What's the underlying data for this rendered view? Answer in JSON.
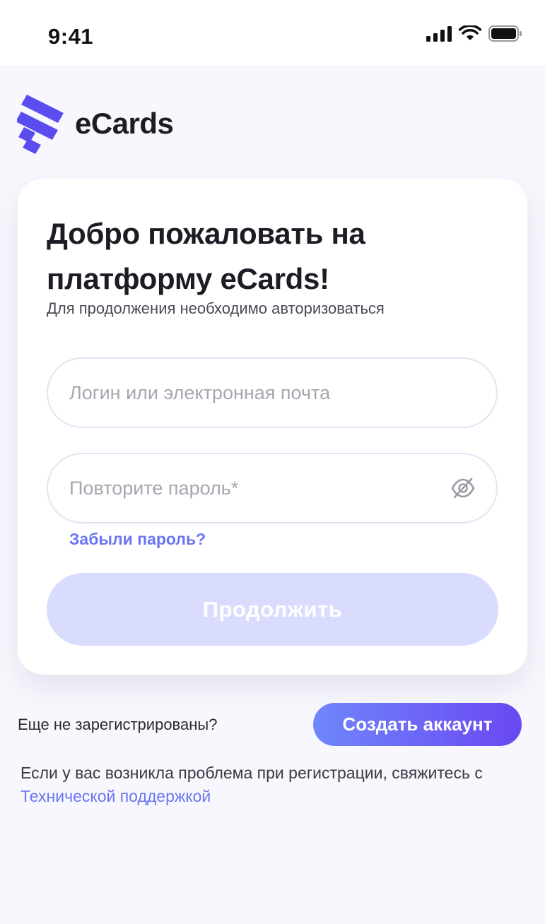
{
  "status_bar": {
    "time": "9:41",
    "signal_icon": "cellular-signal-icon",
    "wifi_icon": "wifi-icon",
    "battery_icon": "battery-icon"
  },
  "brand": {
    "name": "eCards",
    "logo_icon": "ecards-logo-icon",
    "color": "#5b4cf0"
  },
  "card": {
    "title": "Добро пожаловать на платформу eCards!",
    "subtitle": "Для продолжения необходимо авторизоваться",
    "login": {
      "placeholder": "Логин или электронная почта",
      "value": ""
    },
    "password": {
      "placeholder": "Повторите пароль*",
      "value": "",
      "toggle_icon": "eye-off-icon"
    },
    "forgot_label": "Забыли пароль?",
    "continue_label": "Продолжить"
  },
  "register": {
    "prompt": "Еще не зарегистрированы?",
    "create_label": "Создать аккаунт"
  },
  "help": {
    "text": "Если у вас возникла проблема при регистрации, свяжитесь с ",
    "link": "Технической поддержкой"
  },
  "colors": {
    "accent": "#6a76f0",
    "button_disabled": "#d9dcfd",
    "gradient_start": "#6f86fb",
    "gradient_end": "#6a48f2",
    "background": "#f7f7fd"
  }
}
